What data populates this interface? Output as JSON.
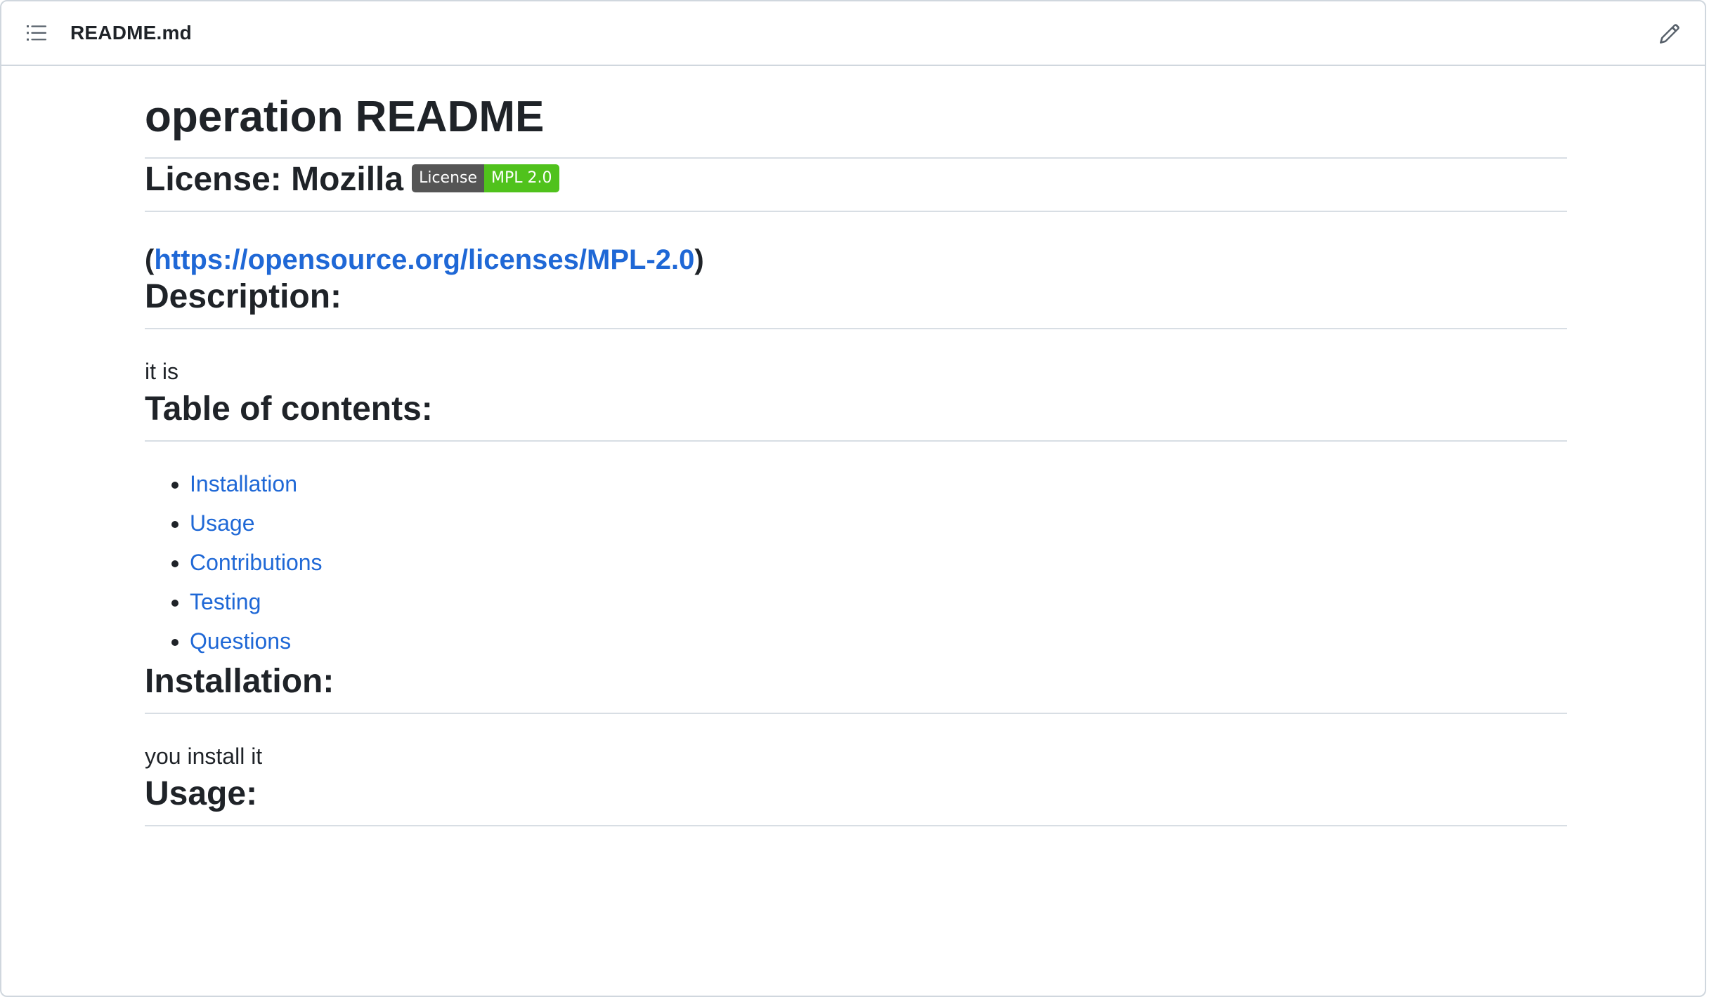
{
  "header": {
    "file_name": "README.md",
    "toc_icon": "list-outline-icon",
    "edit_icon": "pencil-icon"
  },
  "readme": {
    "title": "operation README",
    "license_heading": "License: Mozilla",
    "badge": {
      "label": "License",
      "message": "MPL 2.0",
      "label_color": "#555555",
      "message_color": "#50c21c"
    },
    "license_link_open": "(",
    "license_link_text": "https://opensource.org/licenses/MPL-2.0",
    "license_link_close": ")",
    "description_heading": "Description:",
    "description_text": "it is",
    "toc_heading": "Table of contents:",
    "toc_items": [
      {
        "label": "Installation"
      },
      {
        "label": "Usage"
      },
      {
        "label": "Contributions"
      },
      {
        "label": "Testing"
      },
      {
        "label": "Questions"
      }
    ],
    "installation_heading": "Installation:",
    "installation_text": "you install it",
    "usage_heading": "Usage:"
  },
  "colors": {
    "link": "#1f68d6",
    "text": "#1f2328",
    "border": "#d0d7de"
  }
}
